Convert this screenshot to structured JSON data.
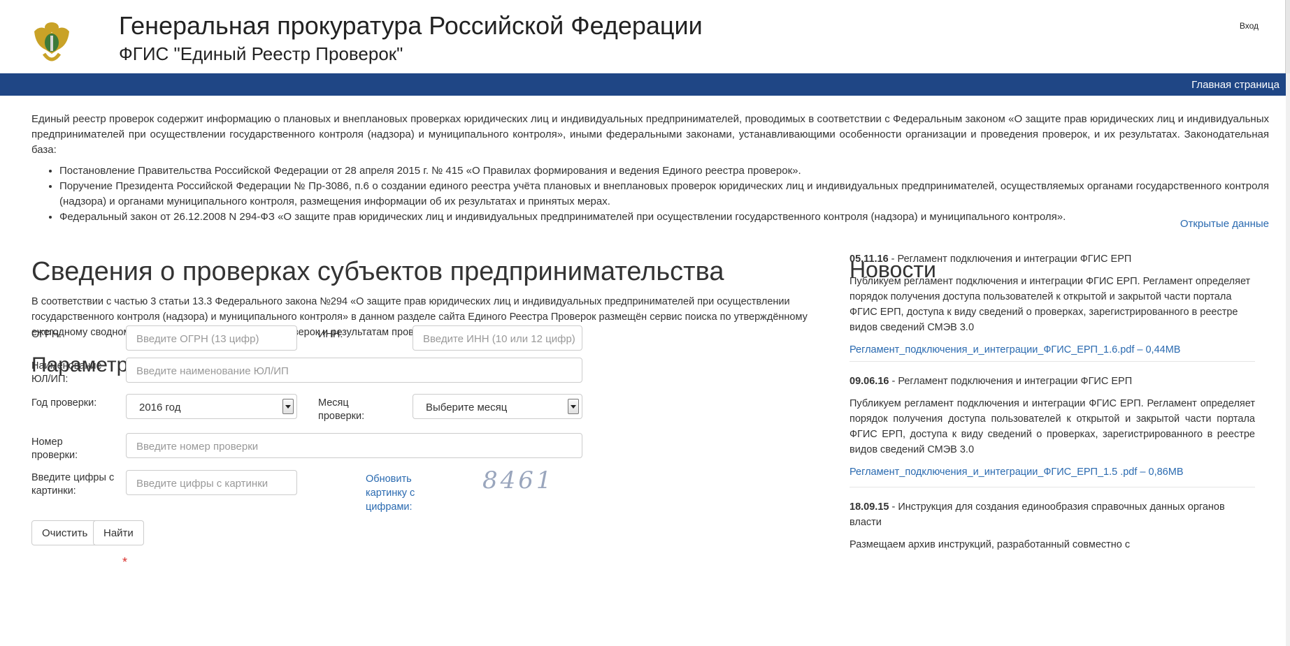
{
  "header": {
    "title": "Генеральная прокуратура Российской Федерации",
    "subtitle": "ФГИС \"Единый Реестр Проверок\"",
    "login": "Вход",
    "logo_icon": "emblem-eagle-icon"
  },
  "nav": {
    "home": "Главная страница",
    "bg_color": "#1f4685"
  },
  "intro": {
    "text": "Единый реестр проверок содержит информацию о плановых и внеплановых проверках юридических лиц и индивидуальных предпринимателей, проводимых в соответствии с Федеральным законом «О защите прав юридических лиц и индивидуальных предпринимателей при осуществлении государственного контроля (надзора) и муниципального контроля», иными федеральными законами, устанавливающими особенности организации и проведения проверок, и их результатах. Законодательная база:",
    "items": [
      "Постановление Правительства Российской Федерации от 28 апреля 2015 г. № 415 «О Правилах формирования и ведения Единого реестра проверок».",
      "Поручение Президента Российской Федерации № Пр-3086, п.6 о создании единого реестра учёта плановых и внеплановых проверок юридических лиц и индивидуальных предпринимателей, осуществляемых органами государственного контроля (надзора) и органами муниципального контроля, размещения информации об их результатах и принятых мерах.",
      "Федеральный закон от 26.12.2008 N 294-ФЗ «О защите прав юридических лиц и индивидуальных предпринимателей при осуществлении государственного контроля (надзора) и муниципального контроля»."
    ],
    "open_data": "Открытые данные"
  },
  "main": {
    "title": "Сведения о проверках субъектов предпринимательства",
    "description": "В соответствии с частью 3 статьи 13.3 Федерального закона №294 «О защите прав юридических лиц и индивидуальных предпринимателей при осуществлении государственного контроля (надзора) и муниципального контроля» в данном разделе сайта Единого Реестра Проверок размещён сервис поиска по утверждённому ежегодному сводному плану проведения плановых проверок и результатам проведения внеплановых проверок.",
    "search_title": "Параметры поиска"
  },
  "form": {
    "ogrn_label": "ОГРН:",
    "ogrn_placeholder": "Введите ОГРН (13 цифр)",
    "inn_label": "ИНН:",
    "inn_placeholder": "Введите ИНН (10 или 12 цифр)",
    "name_label": "Наименование ЮЛ/ИП:",
    "name_placeholder": "Введите наименование ЮЛ/ИП",
    "year_label": "Год проверки:",
    "year_value": "2016 год",
    "month_label": "Месяц проверки:",
    "month_value": "Выберите месяц",
    "number_label": "Номер проверки:",
    "number_placeholder": "Введите номер проверки",
    "captcha_label": "Введите цифры с картинки:",
    "captcha_required": "*",
    "captcha_placeholder": "Введите цифры с картинки",
    "captcha_refresh": "Обновить картинку с цифрами:",
    "captcha_code": "8461",
    "clear_button": "Очистить",
    "find_button": "Найти"
  },
  "news": {
    "title": "Новости",
    "items": [
      {
        "date": "05.11.16",
        "headline": " - Регламент подключения и интеграции ФГИС ЕРП",
        "body": "Публикуем регламент подключения и интеграции ФГИС ЕРП. Регламент определяет порядок получения доступа пользователей к открытой и закрытой части портала ФГИС ЕРП, доступа к виду сведений о проверках, зарегистрированного в реестре видов сведений СМЭВ 3.0",
        "link": "Регламент_подключения_и_интеграции_ФГИС_ЕРП_1.6.pdf",
        "size": " – 0,44MB"
      },
      {
        "date": "09.06.16",
        "headline": " - Регламент подключения и интеграции ФГИС ЕРП",
        "body": "Публикуем регламент подключения и интеграции ФГИС ЕРП. Регламент определяет порядок получения доступа пользователей к открытой и закрытой части портала ФГИС ЕРП, доступа к виду сведений о проверках, зарегистрированного в реестре видов сведений СМЭВ 3.0",
        "link": "Регламент_подключения_и_интеграции_ФГИС_ЕРП_1.5 .pdf",
        "size": " – 0,86MB"
      },
      {
        "date": "18.09.15",
        "headline": " - Инструкция для создания единообразия справочных данных органов власти",
        "body": "Размещаем архив инструкций, разработанный совместно с"
      }
    ]
  }
}
